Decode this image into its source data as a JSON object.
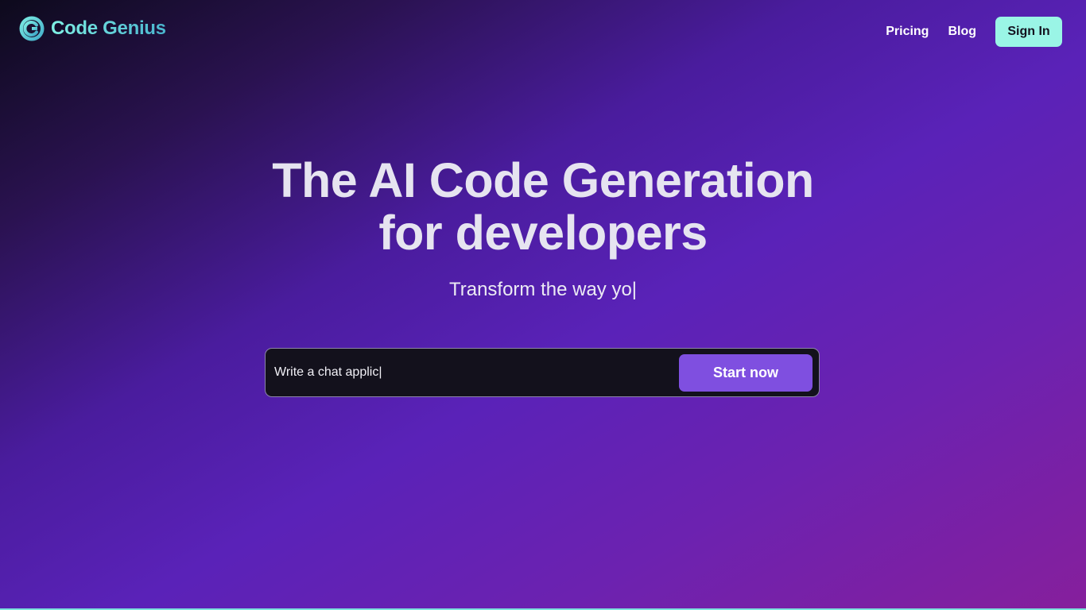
{
  "header": {
    "brand_name": "Code Genius",
    "brand_icon": "c-logo-icon",
    "nav": [
      {
        "label": "Pricing"
      },
      {
        "label": "Blog"
      }
    ],
    "signin_label": "Sign In"
  },
  "hero": {
    "title_line1": "The AI Code Generation",
    "title_line2": "for developers",
    "subtitle": "Transform the way yo|"
  },
  "prompt": {
    "value": "Write a chat applic|",
    "button_label": "Start now"
  },
  "colors": {
    "accent_teal": "#9af5e6",
    "button_purple": "#7f4fe0",
    "background_dark": "#0d0a1c",
    "background_purple": "#5a22b8"
  }
}
